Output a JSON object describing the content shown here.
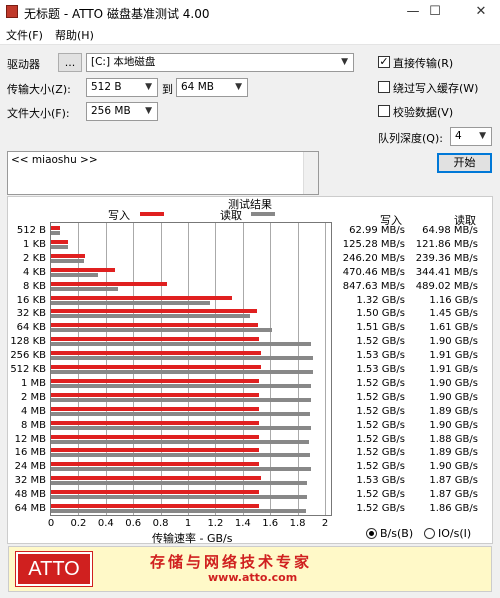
{
  "window": {
    "title": "无标题 - ATTO 磁盘基准测试 4.00",
    "minimize": "—",
    "maximize": "☐",
    "close": "✕"
  },
  "menu": {
    "file": "文件(F)",
    "help": "帮助(H)"
  },
  "settings": {
    "drive_label": "驱动器",
    "browse_button": "...",
    "drive_value": "[C:] 本地磁盘",
    "transfer_size_label": "传输大小(Z):",
    "transfer_from": "512 B",
    "transfer_to_label": "到",
    "transfer_to": "64 MB",
    "file_size_label": "文件大小(F):",
    "file_size": "256 MB"
  },
  "options": {
    "direct_io": {
      "label": "直接传输(R)",
      "checked": true,
      "mark": "✓"
    },
    "bypass_write_cache": {
      "label": "绕过写入缓存(W)",
      "checked": false,
      "mark": ""
    },
    "verify_data": {
      "label": "校验数据(V)",
      "checked": false,
      "mark": ""
    },
    "queue_depth_label": "队列深度(Q):",
    "queue_depth": "4",
    "start_button": "开始"
  },
  "notes": {
    "text": "<< miaoshu >>"
  },
  "results": {
    "title": "测试结果",
    "legend_write": "写入",
    "legend_read": "读取",
    "col_write": "写入",
    "col_read": "读取",
    "axis_label": "传输速率 - GB/s",
    "unit_bytes": "B/s(B)",
    "unit_io": "IO/s(I)",
    "unit_selected": "bytes"
  },
  "chart_data": {
    "type": "bar",
    "orientation": "horizontal",
    "xlabel": "传输速率 - GB/s",
    "xlim": [
      0,
      2
    ],
    "x_ticks": [
      "0",
      "0.2",
      "0.4",
      "0.6",
      "0.8",
      "1",
      "1.2",
      "1.4",
      "1.6",
      "1.8",
      "2"
    ],
    "grid": true,
    "legend_position": "top",
    "categories": [
      "512 B",
      "1 KB",
      "2 KB",
      "4 KB",
      "8 KB",
      "16 KB",
      "32 KB",
      "64 KB",
      "128 KB",
      "256 KB",
      "512 KB",
      "1 MB",
      "2 MB",
      "4 MB",
      "8 MB",
      "12 MB",
      "16 MB",
      "24 MB",
      "32 MB",
      "48 MB",
      "64 MB"
    ],
    "series": [
      {
        "name": "写入",
        "color": "#e02020",
        "values": [
          0.06299,
          0.12528,
          0.2462,
          0.47046,
          0.84763,
          1.32,
          1.5,
          1.51,
          1.52,
          1.53,
          1.53,
          1.52,
          1.52,
          1.52,
          1.52,
          1.52,
          1.52,
          1.52,
          1.53,
          1.52,
          1.52
        ]
      },
      {
        "name": "读取",
        "color": "#888888",
        "values": [
          0.06498,
          0.12186,
          0.23936,
          0.34441,
          0.48902,
          1.16,
          1.45,
          1.61,
          1.9,
          1.91,
          1.91,
          1.9,
          1.9,
          1.89,
          1.9,
          1.88,
          1.89,
          1.9,
          1.87,
          1.87,
          1.86
        ]
      }
    ],
    "write_labels": [
      "62.99 MB/s",
      "125.28 MB/s",
      "246.20 MB/s",
      "470.46 MB/s",
      "847.63 MB/s",
      "1.32 GB/s",
      "1.50 GB/s",
      "1.51 GB/s",
      "1.52 GB/s",
      "1.53 GB/s",
      "1.53 GB/s",
      "1.52 GB/s",
      "1.52 GB/s",
      "1.52 GB/s",
      "1.52 GB/s",
      "1.52 GB/s",
      "1.52 GB/s",
      "1.52 GB/s",
      "1.53 GB/s",
      "1.52 GB/s",
      "1.52 GB/s"
    ],
    "read_labels": [
      "64.98 MB/s",
      "121.86 MB/s",
      "239.36 MB/s",
      "344.41 MB/s",
      "489.02 MB/s",
      "1.16 GB/s",
      "1.45 GB/s",
      "1.61 GB/s",
      "1.90 GB/s",
      "1.91 GB/s",
      "1.91 GB/s",
      "1.90 GB/s",
      "1.90 GB/s",
      "1.89 GB/s",
      "1.90 GB/s",
      "1.88 GB/s",
      "1.89 GB/s",
      "1.90 GB/s",
      "1.87 GB/s",
      "1.87 GB/s",
      "1.86 GB/s"
    ]
  },
  "footer": {
    "logo": "ATTO",
    "slogan": "存储与网络技术专家",
    "url": "www.atto.com"
  }
}
